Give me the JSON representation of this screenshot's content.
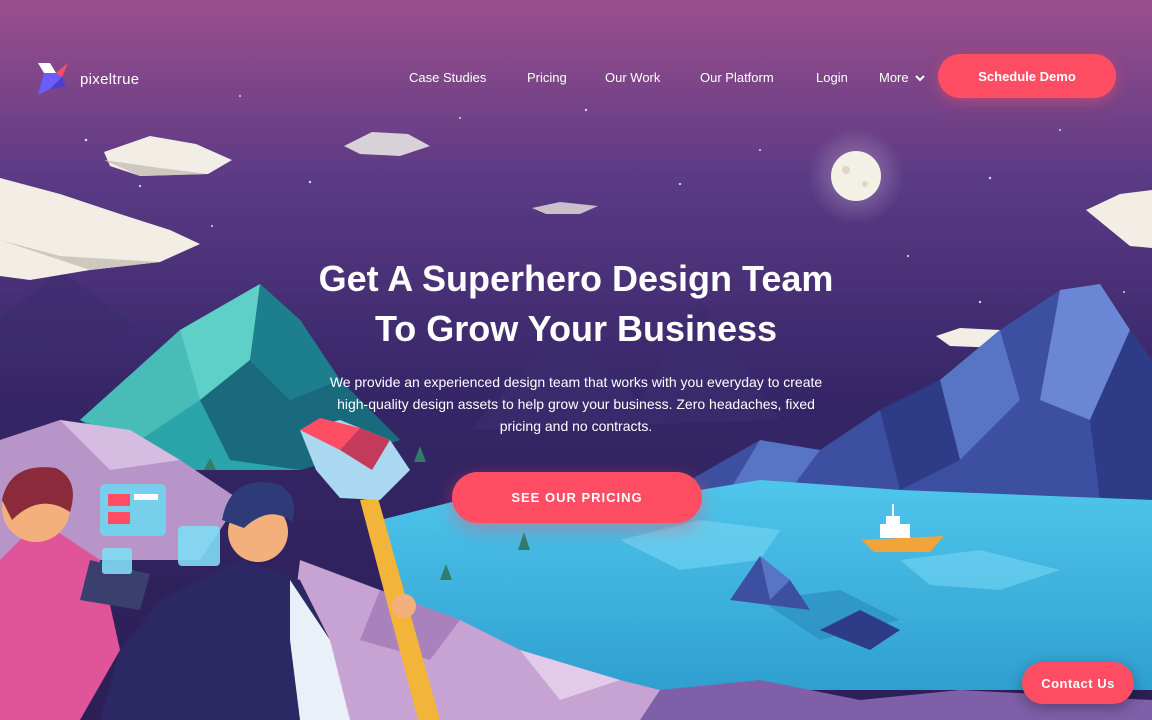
{
  "brand": {
    "name": "pixeltrue",
    "logo_icon": "pixeltrue-logo-icon"
  },
  "nav": {
    "links": [
      "Case Studies",
      "Pricing",
      "Our Work",
      "Our Platform",
      "Login"
    ],
    "more_label": "More",
    "more_icon": "chevron-down-icon",
    "cta_label": "Schedule Demo"
  },
  "hero": {
    "title_line1": "Get A Superhero Design Team",
    "title_line2": "To Grow Your Business",
    "description": "We provide an experienced design team that works with you everyday to create high-quality design assets to help grow your business. Zero headaches, fixed pricing and no contracts.",
    "cta_label": "SEE OUR PRICING"
  },
  "contact": {
    "label": "Contact Us"
  },
  "colors": {
    "accent": "#ff4d64",
    "sky_top": "#9b4f8c",
    "sky_bottom": "#2b1f55",
    "water": "#3fb8e0"
  }
}
